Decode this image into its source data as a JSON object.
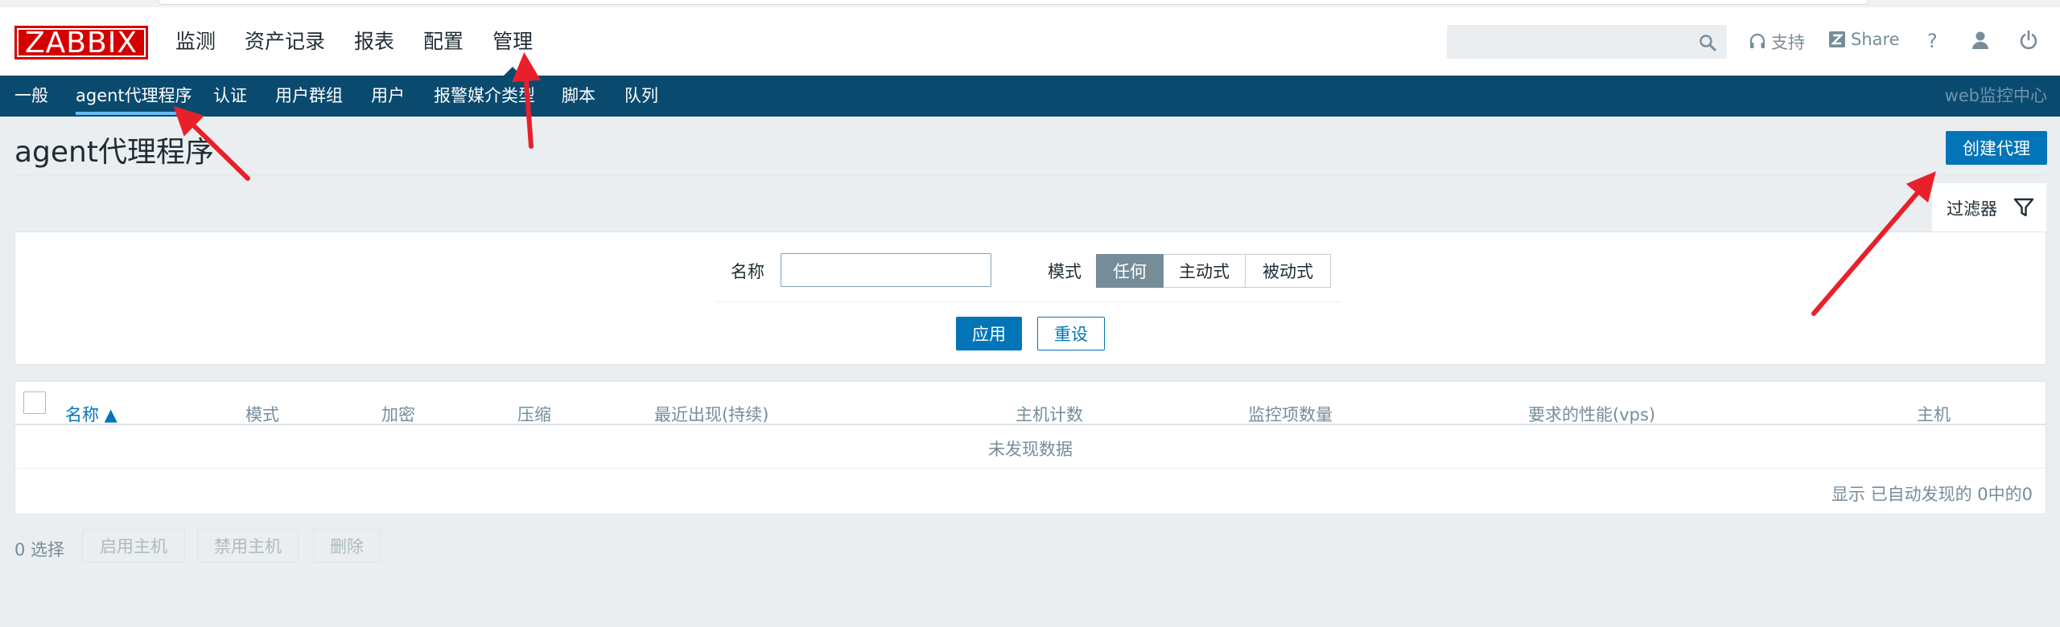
{
  "header": {
    "logo_text": "ZABBIX",
    "main_nav": [
      "监测",
      "资产记录",
      "报表",
      "配置",
      "管理"
    ],
    "active_main": "管理",
    "search": {
      "value": "",
      "placeholder": ""
    },
    "support_label": "支持",
    "share_label": "Share",
    "help_label": "?"
  },
  "subnav": {
    "items": [
      "一般",
      "agent代理程序",
      "认证",
      "用户群组",
      "用户",
      "报警媒介类型",
      "脚本",
      "队列"
    ],
    "active": "agent代理程序",
    "brand": "web监控中心"
  },
  "page": {
    "title": "agent代理程序",
    "create_button": "创建代理"
  },
  "filter": {
    "tab_label": "过滤器",
    "name_label": "名称",
    "name_value": "",
    "mode_label": "模式",
    "mode_options": [
      "任何",
      "主动式",
      "被动式"
    ],
    "mode_selected": "任何",
    "apply_label": "应用",
    "reset_label": "重设"
  },
  "table": {
    "columns": [
      "名称 ▲",
      "模式",
      "加密",
      "压缩",
      "最近出现(持续)",
      "主机计数",
      "监控项数量",
      "要求的性能(vps)",
      "主机"
    ],
    "sorted_column": "名称 ▲",
    "empty_message": "未发现数据",
    "footer": "显示 已自动发现的 0中的0"
  },
  "actions": {
    "selected_count": "0 选择",
    "buttons": [
      "启用主机",
      "禁用主机",
      "删除"
    ]
  },
  "colors": {
    "subnav_bg": "#0b4a6f",
    "accent": "#0275b8",
    "logo_red": "#d40000",
    "annotation_arrow": "#e8202a"
  }
}
